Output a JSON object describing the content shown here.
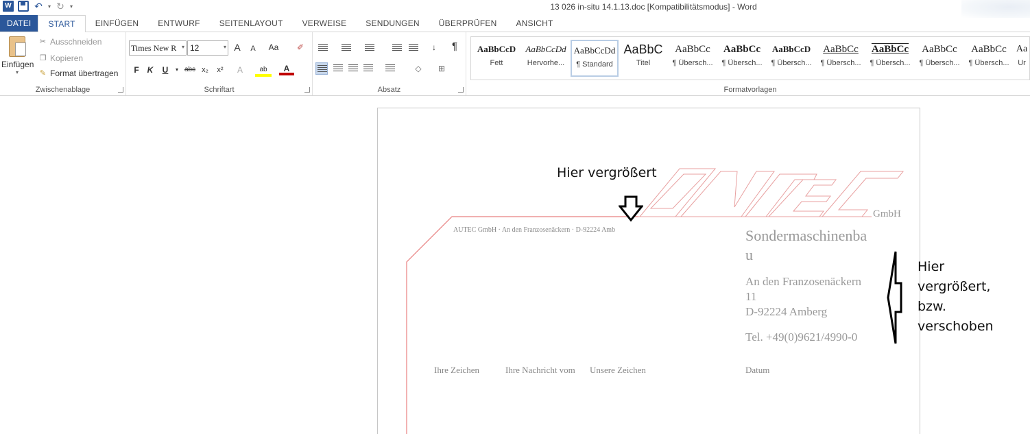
{
  "window": {
    "title": "13 026 in-situ 14.1.13.doc [Kompatibilitätsmodus] - Word",
    "app_icon_letter": "W"
  },
  "tabs": [
    {
      "label": "DATEI"
    },
    {
      "label": "START"
    },
    {
      "label": "EINFÜGEN"
    },
    {
      "label": "ENTWURF"
    },
    {
      "label": "SEITENLAYOUT"
    },
    {
      "label": "VERWEISE"
    },
    {
      "label": "SENDUNGEN"
    },
    {
      "label": "ÜBERPRÜFEN"
    },
    {
      "label": "ANSICHT"
    }
  ],
  "clipboard": {
    "paste": "Einfügen",
    "cut": "Ausschneiden",
    "copy": "Kopieren",
    "format_painter": "Format übertragen",
    "label": "Zwischenablage"
  },
  "font": {
    "name": "Times New R",
    "size": "12",
    "grow": "A",
    "shrink": "A",
    "case": "Aa",
    "bold": "F",
    "italic": "K",
    "underline": "U",
    "strike": "abc",
    "sub": "x₂",
    "sup": "x²",
    "label": "Schriftart"
  },
  "paragraph": {
    "label": "Absatz",
    "pilcrow": "¶"
  },
  "styles": {
    "label": "Formatvorlagen",
    "items": [
      {
        "sample": "AaBbCcD",
        "label": "Fett"
      },
      {
        "sample": "AaBbCcDd",
        "label": "Hervorhe..."
      },
      {
        "sample": "AaBbCcDd",
        "label": "¶ Standard"
      },
      {
        "sample": "AaBbC",
        "label": "Titel"
      },
      {
        "sample": "AaBbCc",
        "label": "¶ Übersch..."
      },
      {
        "sample": "AaBbCc",
        "label": "¶ Übersch..."
      },
      {
        "sample": "AaBbCcD",
        "label": "¶ Übersch..."
      },
      {
        "sample": "AaBbCc",
        "label": "¶ Übersch..."
      },
      {
        "sample": "AaBbCc",
        "label": "¶ Übersch..."
      },
      {
        "sample": "AaBbCc",
        "label": "¶ Übersch..."
      },
      {
        "sample": "AaBbCc",
        "label": "¶ Übersch..."
      },
      {
        "sample": "Aa",
        "label": "Ur"
      }
    ]
  },
  "document": {
    "logo_suffix": "GmbH",
    "sender_line": "AUTEC GmbH · An den Franzosenäckern · D-92224 Amb",
    "company_line1": "Sondermaschinenba",
    "company_line2": "u",
    "address_line1": "An den Franzosenäckern",
    "address_line2": "11",
    "address_line3": "D-92224 Amberg",
    "phone": "Tel. +49(0)9621/4990-0",
    "ref_your_sign": "Ihre Zeichen",
    "ref_your_message": "Ihre Nachricht vom",
    "ref_our_sign": "Unsere Zeichen",
    "ref_date": "Datum"
  },
  "annotations": {
    "top": "Hier vergrößert",
    "right_line1": "Hier",
    "right_line2": "vergrößert,",
    "right_line3": "bzw.",
    "right_line4": "verschoben"
  },
  "colors": {
    "file_tab": "#2b579a",
    "logo_stroke": "#e8a0a0",
    "margin_line": "#e88080"
  }
}
